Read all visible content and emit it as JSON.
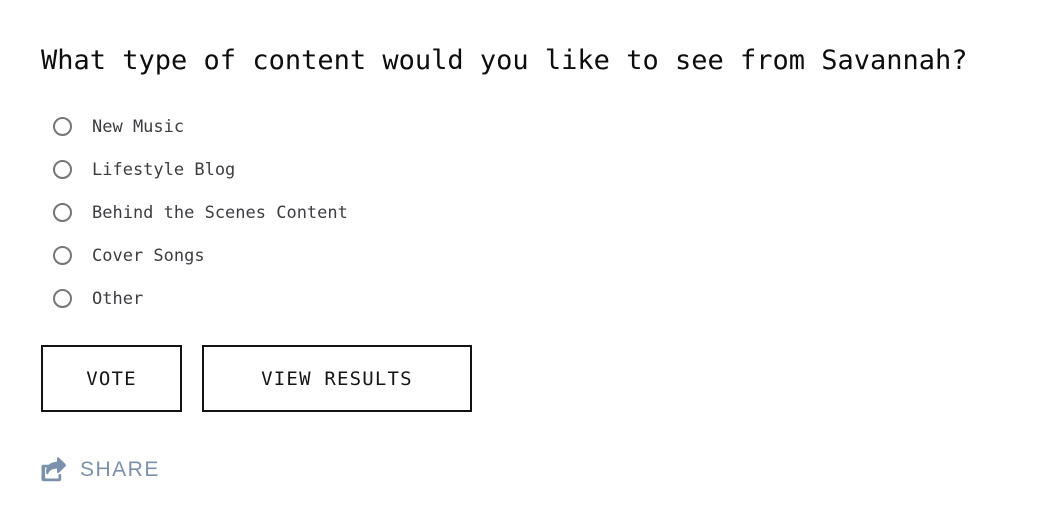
{
  "poll": {
    "question": "What type of content would you like to see from Savannah?",
    "options": [
      {
        "label": "New Music",
        "selected": false
      },
      {
        "label": "Lifestyle Blog",
        "selected": false
      },
      {
        "label": "Behind the Scenes Content",
        "selected": false
      },
      {
        "label": "Cover Songs",
        "selected": false
      },
      {
        "label": "Other",
        "selected": false
      }
    ],
    "buttons": {
      "vote": "VOTE",
      "view_results": "VIEW RESULTS"
    },
    "share": {
      "label": "SHARE",
      "icon": "share-square-icon"
    },
    "colors": {
      "background": "#ffffff",
      "question_text": "#0d0d0d",
      "option_text": "#3c3d41",
      "radio_outline": "#75767a",
      "button_border": "#111315",
      "button_text": "#141517",
      "share_accent": "#7b91ab"
    }
  }
}
